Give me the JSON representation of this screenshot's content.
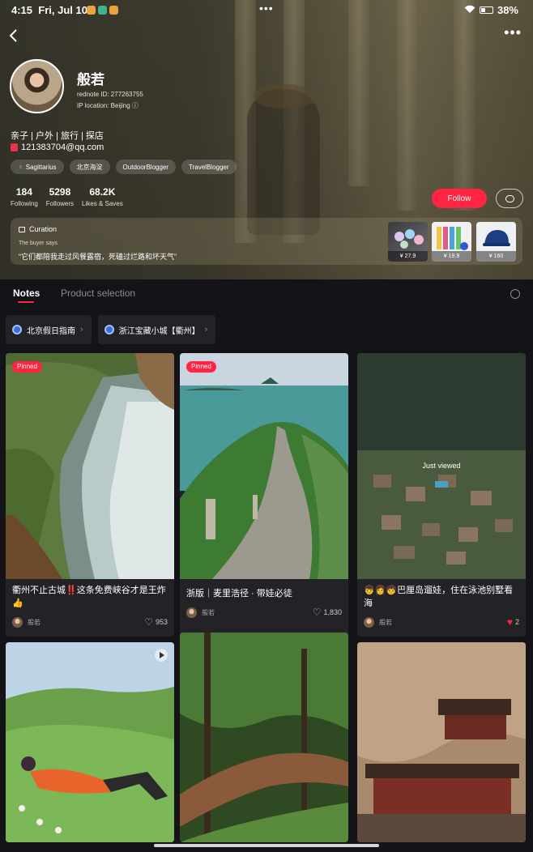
{
  "status_bar": {
    "time": "4:15",
    "date": "Fri, Jul 10",
    "battery": "38%"
  },
  "colors": {
    "accent": "#ff2442",
    "background": "#141418",
    "card": "#232327"
  },
  "profile": {
    "name": "般若",
    "rednote_id": "rednote ID: 277263755",
    "ip_location": "IP location: Beijing",
    "bio": "亲子 | 户外 | 旅行 | 探店",
    "email": "121383704@qq.com",
    "tags": [
      "Sagittarius",
      "北京海淀",
      "OutdoorBlogger",
      "TravelBlogger"
    ],
    "stats": [
      {
        "value": "184",
        "label": "Following"
      },
      {
        "value": "5298",
        "label": "Followers"
      },
      {
        "value": "68.2K",
        "label": "Likes & Saves"
      }
    ],
    "follow_label": "Follow"
  },
  "curation": {
    "title": "Curation",
    "subtitle": "The buyer says",
    "quote": "“它们都陪我走过风餐露宿，死磕过烂路和坏天气”",
    "products": [
      {
        "price": "¥ 27.9"
      },
      {
        "price": "¥ 19.9"
      },
      {
        "price": "¥ 160"
      }
    ]
  },
  "tabs": [
    {
      "label": "Notes"
    },
    {
      "label": "Product selection"
    }
  ],
  "collections": [
    {
      "label": "北京假日指南"
    },
    {
      "label": "浙江宝藏小城【衢州】"
    }
  ],
  "notes": [
    {
      "title": "衢州不止古城‼️这条免费峡谷才是王炸👍",
      "author": "般若",
      "likes": "953",
      "pinned": "Pinned"
    },
    {
      "title": "浙版｜麦里浩径 · 带娃必徒",
      "author": "般若",
      "likes": "1,830",
      "pinned": "Pinned"
    },
    {
      "title": "👦👩🧒巴厘岛遛娃，住在泳池别墅看海",
      "author": "般若",
      "likes": "2",
      "overlay": "Just viewed"
    }
  ],
  "icons": [
    "back-arrow-icon",
    "more-icon",
    "mail-icon",
    "gender-icon",
    "chat-icon",
    "lock-icon",
    "search-icon",
    "collection-icon",
    "chevron-right-icon",
    "heart-icon",
    "play-icon"
  ]
}
